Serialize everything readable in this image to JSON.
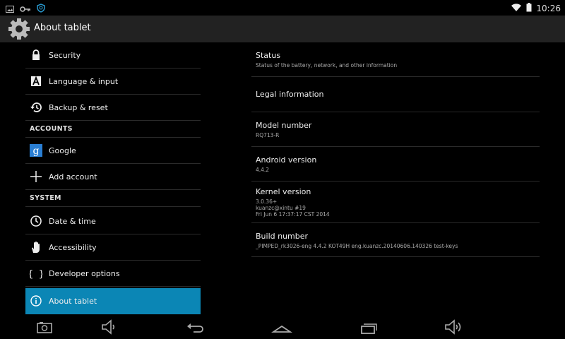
{
  "status_bar": {
    "time": "10:26",
    "left_icons": [
      "screenshot-icon",
      "key-icon",
      "shield-icon"
    ],
    "right_icons": [
      "wifi-icon",
      "battery-icon"
    ]
  },
  "action_bar": {
    "title": "About tablet",
    "icon": "settings-gear-icon"
  },
  "sidebar": {
    "items": [
      {
        "label": "Security",
        "icon": "lock-icon"
      },
      {
        "label": "Language & input",
        "icon": "keyboard-a-icon"
      },
      {
        "label": "Backup & reset",
        "icon": "backup-restore-icon"
      },
      {
        "header": "ACCOUNTS"
      },
      {
        "label": "Google",
        "icon": "google-icon"
      },
      {
        "label": "Add account",
        "icon": "plus-icon"
      },
      {
        "header": "SYSTEM"
      },
      {
        "label": "Date & time",
        "icon": "clock-icon"
      },
      {
        "label": "Accessibility",
        "icon": "hand-icon"
      },
      {
        "label": "Developer options",
        "icon": "braces-icon"
      },
      {
        "label": "About tablet",
        "icon": "info-icon",
        "selected": true
      }
    ]
  },
  "details": {
    "status": {
      "title": "Status",
      "summary": "Status of the battery, network, and other information"
    },
    "legal": {
      "title": "Legal information"
    },
    "model": {
      "title": "Model number",
      "value": "RQ713-R"
    },
    "android": {
      "title": "Android version",
      "value": "4.4.2"
    },
    "kernel": {
      "title": "Kernel version",
      "line1": "3.0.36+",
      "line2": "kuanzc@xintu #19",
      "line3": "Fri Jun 6 17:37:17 CST 2014"
    },
    "build": {
      "title": "Build number",
      "value": "_PIMPED_rk3026-eng 4.4.2 KOT49H eng.kuanzc.20140606.140326 test-keys"
    }
  },
  "nav_bar": {
    "icons": [
      "camera-icon",
      "volume-down-icon",
      "back-icon",
      "home-icon",
      "recents-icon",
      "volume-up-icon"
    ]
  },
  "colors": {
    "selected": "#0b86b5",
    "action_bar": "#222222",
    "divider": "#2a2a2a"
  }
}
